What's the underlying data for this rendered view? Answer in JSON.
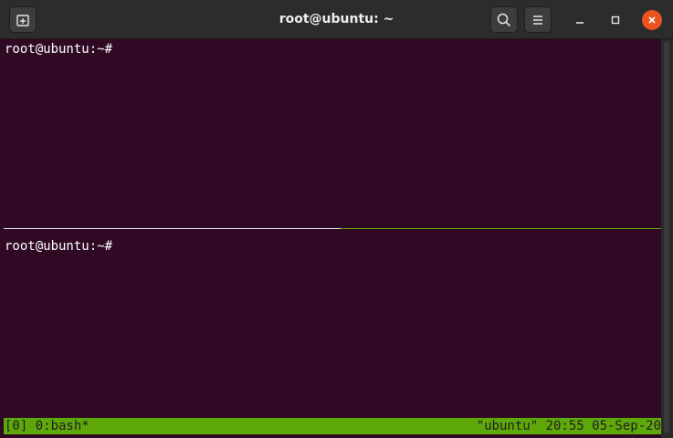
{
  "window": {
    "title": "root@ubuntu: ~",
    "accent_color": "#e95420",
    "icons": {
      "new_tab": "new-tab-icon",
      "search": "search-icon",
      "menu": "hamburger-menu-icon",
      "minimize": "minimize-icon",
      "maximize": "maximize-icon",
      "close": "close-icon"
    }
  },
  "terminal": {
    "background_color": "#300a24",
    "panes": [
      {
        "prompt": "root@ubuntu:~#"
      },
      {
        "prompt": "root@ubuntu:~#"
      }
    ]
  },
  "tmux": {
    "status_color": "#5fa80a",
    "status_left": "[0] 0:bash*",
    "status_right": "\"ubuntu\" 20:55 05-Sep-20"
  }
}
